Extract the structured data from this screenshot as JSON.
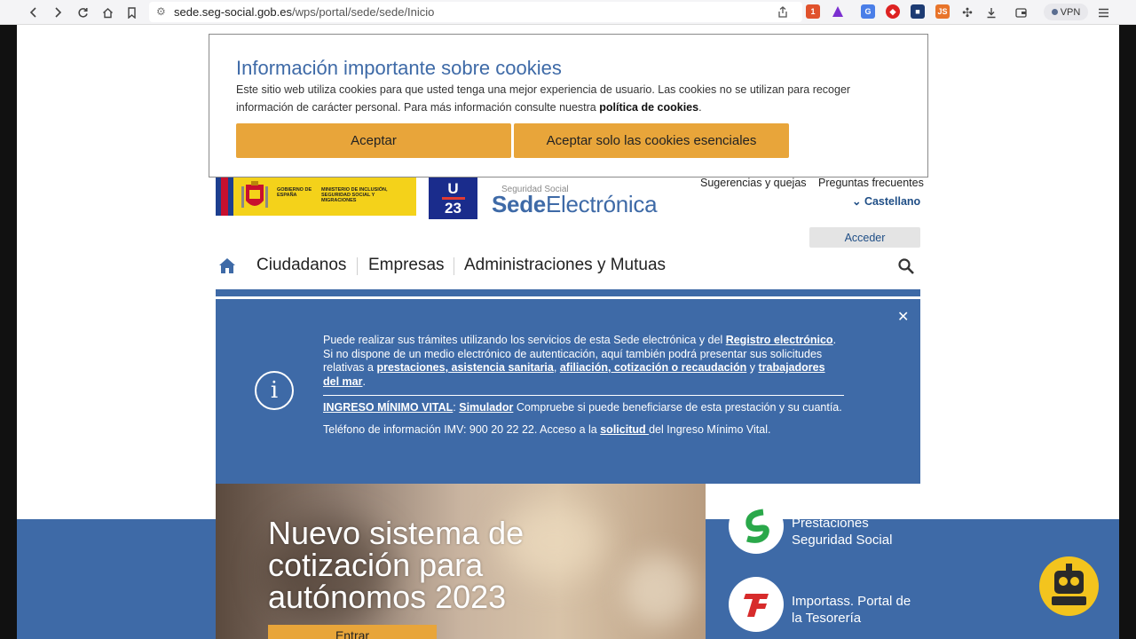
{
  "browser": {
    "url_domain": "sede.seg-social.gob.es",
    "url_path": "/wps/portal/sede/sede/Inicio",
    "vpn_label": "VPN",
    "icons": [
      "back-icon",
      "forward-icon",
      "reload-icon",
      "home-icon",
      "bookmark-icon",
      "share-icon",
      "brave-shield-icon",
      "brave-rewards-icon",
      "translate-icon",
      "extension-icon",
      "menu-icon"
    ]
  },
  "cookie": {
    "title": "Información importante sobre cookies",
    "text": "Este sitio web utiliza cookies para que usted tenga una mejor experiencia de usuario. Las cookies no se utilizan para recoger información de carácter personal. Para más información consulte nuestra ",
    "policy_link": "política de cookies",
    "text_end": ".",
    "accept": "Aceptar",
    "accept_essential": "Aceptar solo las cookies esenciales",
    "accent_color": "#e8a53a"
  },
  "header": {
    "gov_line1": "GOBIERNO DE ESPAÑA",
    "gov_line2": "MINISTERIO DE INCLUSIÓN, SEGURIDAD SOCIAL Y MIGRACIONES",
    "eu_top": "U",
    "eu_bottom": "23",
    "sede_small": "Seguridad Social",
    "sede_bold": "Sede",
    "sede_light": "Electrónica",
    "link_suggestions": "Sugerencias y quejas",
    "link_faq": "Preguntas frecuentes",
    "language": "Castellano",
    "login": "Acceder"
  },
  "nav": {
    "items": [
      "Ciudadanos",
      "Empresas",
      "Administraciones y Mutuas"
    ]
  },
  "info": {
    "p1_a": "Puede realizar sus trámites utilizando los servicios de esta Sede electrónica y del ",
    "p1_link1": "Registro electrónico",
    "p1_b": ". Si no dispone de un medio electrónico de autenticación, aquí también podrá presentar sus solicitudes relativas a ",
    "p1_link2": "prestaciones, asistencia sanitaria",
    "p1_c": ", ",
    "p1_link3": "afiliación, cotización o recaudación",
    "p1_d": " y ",
    "p1_link4": "trabajadores del mar",
    "p1_e": ".",
    "p2_link1": "INGRESO MÍNIMO VITAL",
    "p2_a": ": ",
    "p2_link2": "Simulador",
    "p2_b": " Compruebe si puede beneficiarse de esta prestación y su cuantía.",
    "p3_a": "Teléfono de información IMV: 900 20 22 22. Acceso a la ",
    "p3_link": "solicitud ",
    "p3_b": "del Ingreso Mínimo Vital.",
    "bg_color": "#3e6aa7"
  },
  "hero": {
    "title": "Nuevo sistema de cotización para autónomos 2023",
    "button": "Entrar"
  },
  "side": {
    "item1": "Prestaciones Seguridad Social",
    "item2": "Importass. Portal de la Tesorería"
  }
}
